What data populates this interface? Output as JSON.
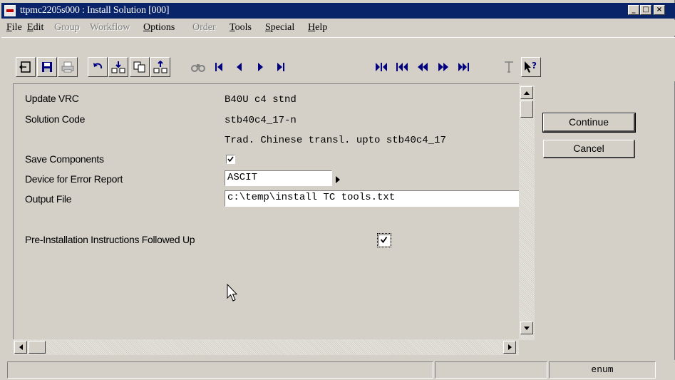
{
  "window": {
    "title": "ttpmc2205s000 : Install Solution [000]",
    "controls": {
      "minimize": "_",
      "maximize": "□",
      "close": "×"
    }
  },
  "menu": [
    {
      "label": "File",
      "enabled": true
    },
    {
      "label": "Edit",
      "enabled": true
    },
    {
      "label": "Group",
      "enabled": false
    },
    {
      "label": "Workflow",
      "enabled": false
    },
    {
      "label": "Options",
      "enabled": true
    },
    {
      "label": "Order",
      "enabled": false
    },
    {
      "label": "Tools",
      "enabled": true
    },
    {
      "label": "Special",
      "enabled": true
    },
    {
      "label": "Help",
      "enabled": true
    }
  ],
  "toolbar": {
    "icons": [
      "exit-icon",
      "save-icon",
      "print-icon",
      "undo-icon",
      "insert-record-icon",
      "copy-record-icon",
      "delete-record-icon",
      "find-icon",
      "first-record-icon",
      "previous-record-icon",
      "next-record-icon",
      "last-record-icon",
      "first-set-icon",
      "previous-set-icon",
      "rewind-icon",
      "forward-icon",
      "last-set-icon",
      "text-icon",
      "context-help-icon"
    ]
  },
  "form": {
    "update_vrc": {
      "label": "Update VRC",
      "value": "B40U  c4 stnd"
    },
    "solution_code": {
      "label": "Solution Code",
      "value": "stb40c4_17-n",
      "description": "Trad. Chinese transl. upto stb40c4_17"
    },
    "save_components": {
      "label": "Save Components",
      "checked": true
    },
    "device": {
      "label": "Device for Error Report",
      "value": "ASCIT"
    },
    "output_file": {
      "label": "Output File",
      "value": "c:\\temp\\install TC tools.txt"
    },
    "pre_install": {
      "label": "Pre-Installation Instructions Followed Up",
      "checked": true
    }
  },
  "buttons": {
    "continue": "Continue",
    "cancel": "Cancel"
  },
  "statusbar": {
    "panel1": "",
    "panel2": "",
    "panel3": "enum"
  },
  "colors": {
    "titlebar": "#0a246a",
    "face": "#d4d0c8"
  }
}
